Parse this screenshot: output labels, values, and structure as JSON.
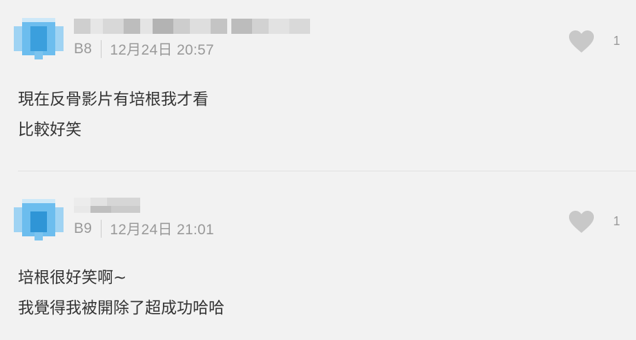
{
  "comments": [
    {
      "floor": "B8",
      "time": "12月24日 20:57",
      "likes": "1",
      "lines": [
        "現在反骨影片有培根我才看",
        "比較好笑"
      ]
    },
    {
      "floor": "B9",
      "time": "12月24日 21:01",
      "likes": "1",
      "lines": [
        "培根很好笑啊~",
        "我覺得我被開除了超成功哈哈"
      ]
    }
  ],
  "colors": {
    "background": "#f2f2f2",
    "meta_text": "#999999",
    "body_text": "#333333",
    "heart": "#c8c8c8",
    "avatar_blue": "#3aa0e0"
  },
  "icons": {
    "like": "heart-icon"
  }
}
